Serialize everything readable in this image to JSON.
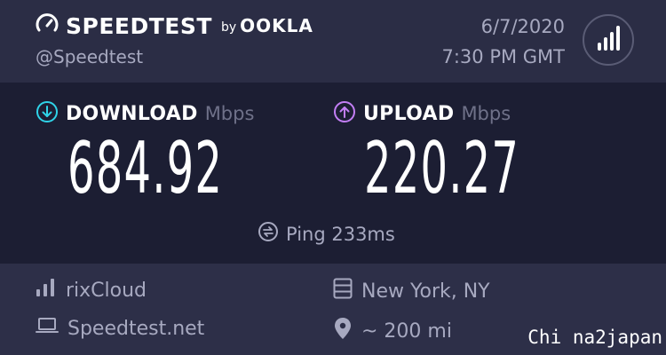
{
  "brand": {
    "name": "SPEEDTEST",
    "by": "by",
    "partner": "OOKLA",
    "handle": "@Speedtest"
  },
  "datetime": {
    "date": "6/7/2020",
    "time": "7:30 PM GMT"
  },
  "download": {
    "label": "DOWNLOAD",
    "unit": "Mbps",
    "value": "684.92",
    "color": "#2fd3e8"
  },
  "upload": {
    "label": "UPLOAD",
    "unit": "Mbps",
    "value": "220.27",
    "color": "#c27ef5"
  },
  "ping": {
    "text": "Ping 233ms"
  },
  "footer": {
    "isp": "rixCloud",
    "server_location": "New York, NY",
    "client": "Speedtest.net",
    "distance": "~ 200 mi"
  },
  "watermark": "Chi na2japan",
  "icons": [
    "speedtest-gauge-icon",
    "results-bars-icon",
    "download-arrow-icon",
    "upload-arrow-icon",
    "ping-icon",
    "signal-bars-icon",
    "server-icon",
    "laptop-icon",
    "location-pin-icon"
  ]
}
